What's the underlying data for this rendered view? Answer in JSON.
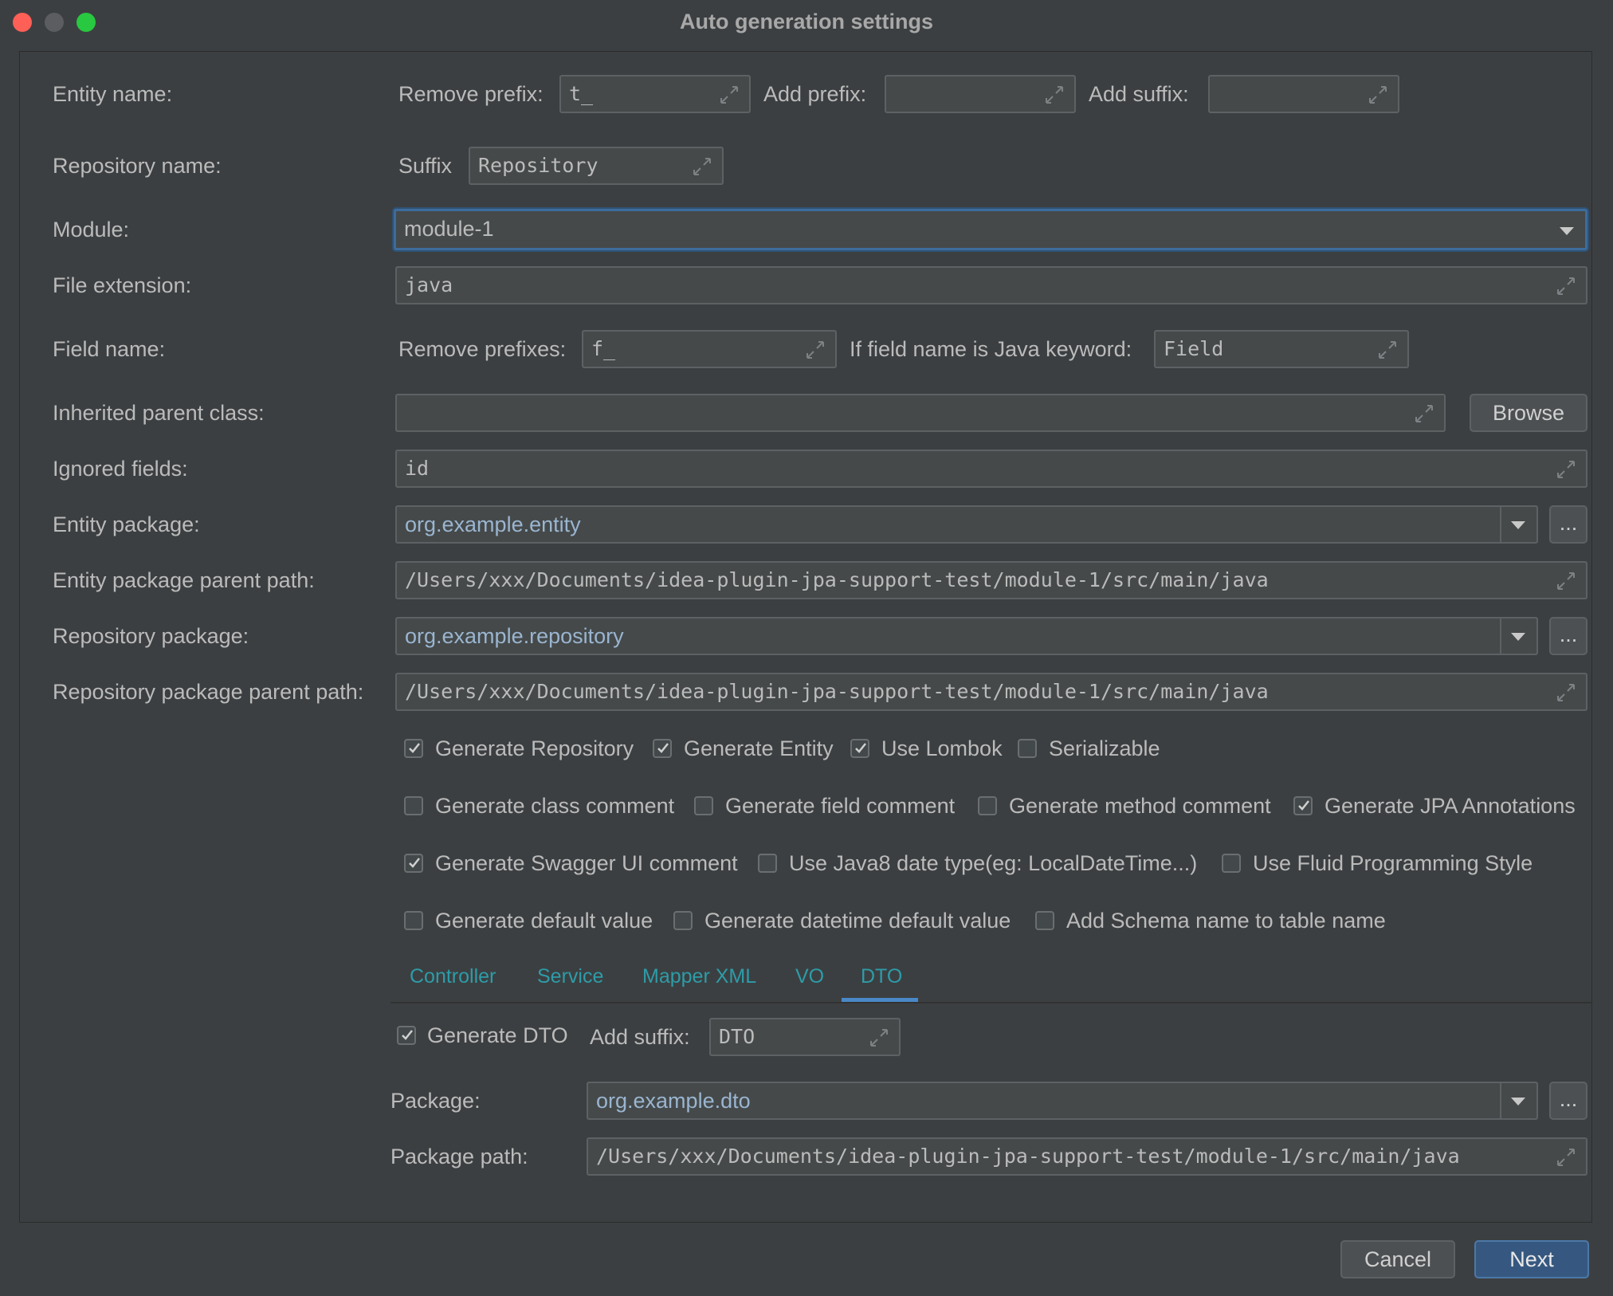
{
  "window": {
    "title": "Auto generation settings"
  },
  "entity_name": {
    "label": "Entity name:",
    "remove_prefix_label": "Remove prefix:",
    "remove_prefix_value": "t_",
    "add_prefix_label": "Add prefix:",
    "add_prefix_value": "",
    "add_suffix_label": "Add suffix:",
    "add_suffix_value": ""
  },
  "repository_name": {
    "label": "Repository name:",
    "suffix_label": "Suffix",
    "suffix_value": "Repository"
  },
  "module": {
    "label": "Module:",
    "value": "module-1"
  },
  "file_extension": {
    "label": "File extension:",
    "value": "java"
  },
  "field_name": {
    "label": "Field name:",
    "remove_prefixes_label": "Remove prefixes:",
    "remove_prefixes_value": "f_",
    "keyword_label": "If field name is Java keyword:",
    "keyword_value": "Field"
  },
  "inherited_parent": {
    "label": "Inherited parent class:",
    "value": "",
    "browse_label": "Browse"
  },
  "ignored_fields": {
    "label": "Ignored fields:",
    "value": "id"
  },
  "entity_package": {
    "label": "Entity package:",
    "value": "org.example.entity",
    "more_label": "..."
  },
  "entity_package_path": {
    "label": "Entity package parent path:",
    "value": "/Users/xxx/Documents/idea-plugin-jpa-support-test/module-1/src/main/java"
  },
  "repository_package": {
    "label": "Repository package:",
    "value": "org.example.repository",
    "more_label": "..."
  },
  "repository_package_path": {
    "label": "Repository package parent path:",
    "value": "/Users/xxx/Documents/idea-plugin-jpa-support-test/module-1/src/main/java"
  },
  "options": {
    "row1": [
      {
        "label": "Generate Repository",
        "checked": true
      },
      {
        "label": "Generate Entity",
        "checked": true
      },
      {
        "label": "Use Lombok",
        "checked": true
      },
      {
        "label": "Serializable",
        "checked": false
      }
    ],
    "row2": [
      {
        "label": "Generate class comment",
        "checked": false
      },
      {
        "label": "Generate field comment",
        "checked": false
      },
      {
        "label": "Generate method comment",
        "checked": false
      },
      {
        "label": "Generate JPA Annotations",
        "checked": true
      }
    ],
    "row3": [
      {
        "label": "Generate Swagger UI comment",
        "checked": true
      },
      {
        "label": "Use Java8 date type(eg: LocalDateTime...)",
        "checked": false
      },
      {
        "label": "Use Fluid Programming Style",
        "checked": false
      }
    ],
    "row4": [
      {
        "label": "Generate default value",
        "checked": false
      },
      {
        "label": "Generate datetime default value",
        "checked": false
      },
      {
        "label": "Add Schema name to table name",
        "checked": false
      }
    ]
  },
  "tabs": [
    {
      "label": "Controller"
    },
    {
      "label": "Service"
    },
    {
      "label": "Mapper XML"
    },
    {
      "label": "VO"
    },
    {
      "label": "DTO",
      "selected": true
    }
  ],
  "dto": {
    "generate_label": "Generate DTO",
    "generate_checked": true,
    "add_suffix_label": "Add suffix:",
    "add_suffix_value": "DTO",
    "package_label": "Package:",
    "package_value": "org.example.dto",
    "more_label": "...",
    "path_label": "Package path:",
    "path_value": "/Users/xxx/Documents/idea-plugin-jpa-support-test/module-1/src/main/java"
  },
  "footer": {
    "cancel_label": "Cancel",
    "next_label": "Next"
  },
  "colors": {
    "background": "#3c3f41",
    "field": "#45494a",
    "accent": "#365880",
    "tab_text": "#2d9ca8",
    "package_text": "#9ab5cf"
  }
}
